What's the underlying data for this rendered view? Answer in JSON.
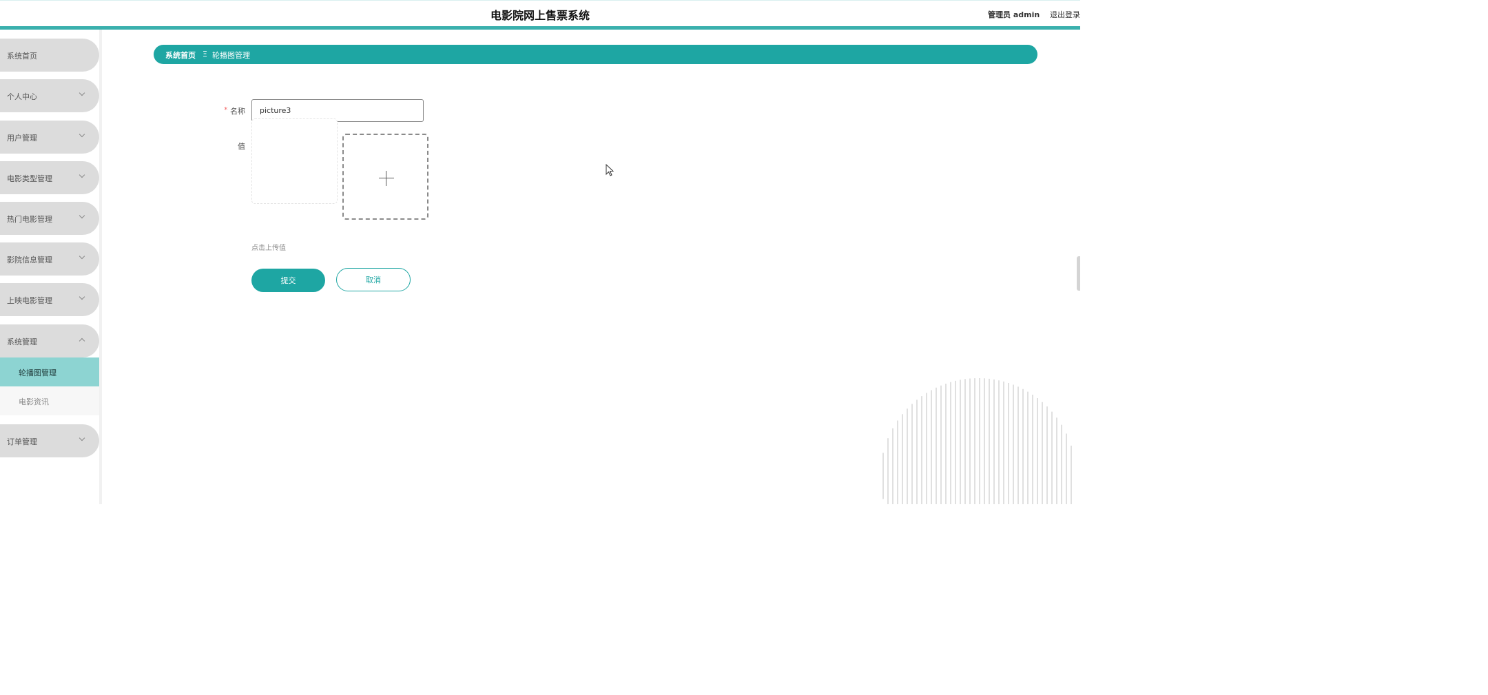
{
  "header": {
    "title": "电影院网上售票系统",
    "user": "管理员 admin",
    "logout": "退出登录"
  },
  "sidebar": {
    "items": [
      {
        "label": "系统首页"
      },
      {
        "label": "个人中心"
      },
      {
        "label": "用户管理"
      },
      {
        "label": "电影类型管理"
      },
      {
        "label": "热门电影管理"
      },
      {
        "label": "影院信息管理"
      },
      {
        "label": "上映电影管理"
      },
      {
        "label": "系统管理"
      },
      {
        "label": "订单管理"
      }
    ],
    "submenu": [
      {
        "label": "轮播图管理",
        "active": true
      },
      {
        "label": "电影资讯",
        "active": false
      }
    ]
  },
  "breadcrumb": {
    "home": "系统首页",
    "separator": "Ξ",
    "current": "轮播图管理"
  },
  "form": {
    "required_mark": "*",
    "name_label": "名称",
    "name_value": "picture3",
    "value_label": "值",
    "upload_tip": "点击上传值",
    "submit_label": "提交",
    "cancel_label": "取消"
  },
  "colors": {
    "accent": "#1ea6a3",
    "active_submenu": "#8dd4d2",
    "menu_bg": "#dcdcdc"
  }
}
